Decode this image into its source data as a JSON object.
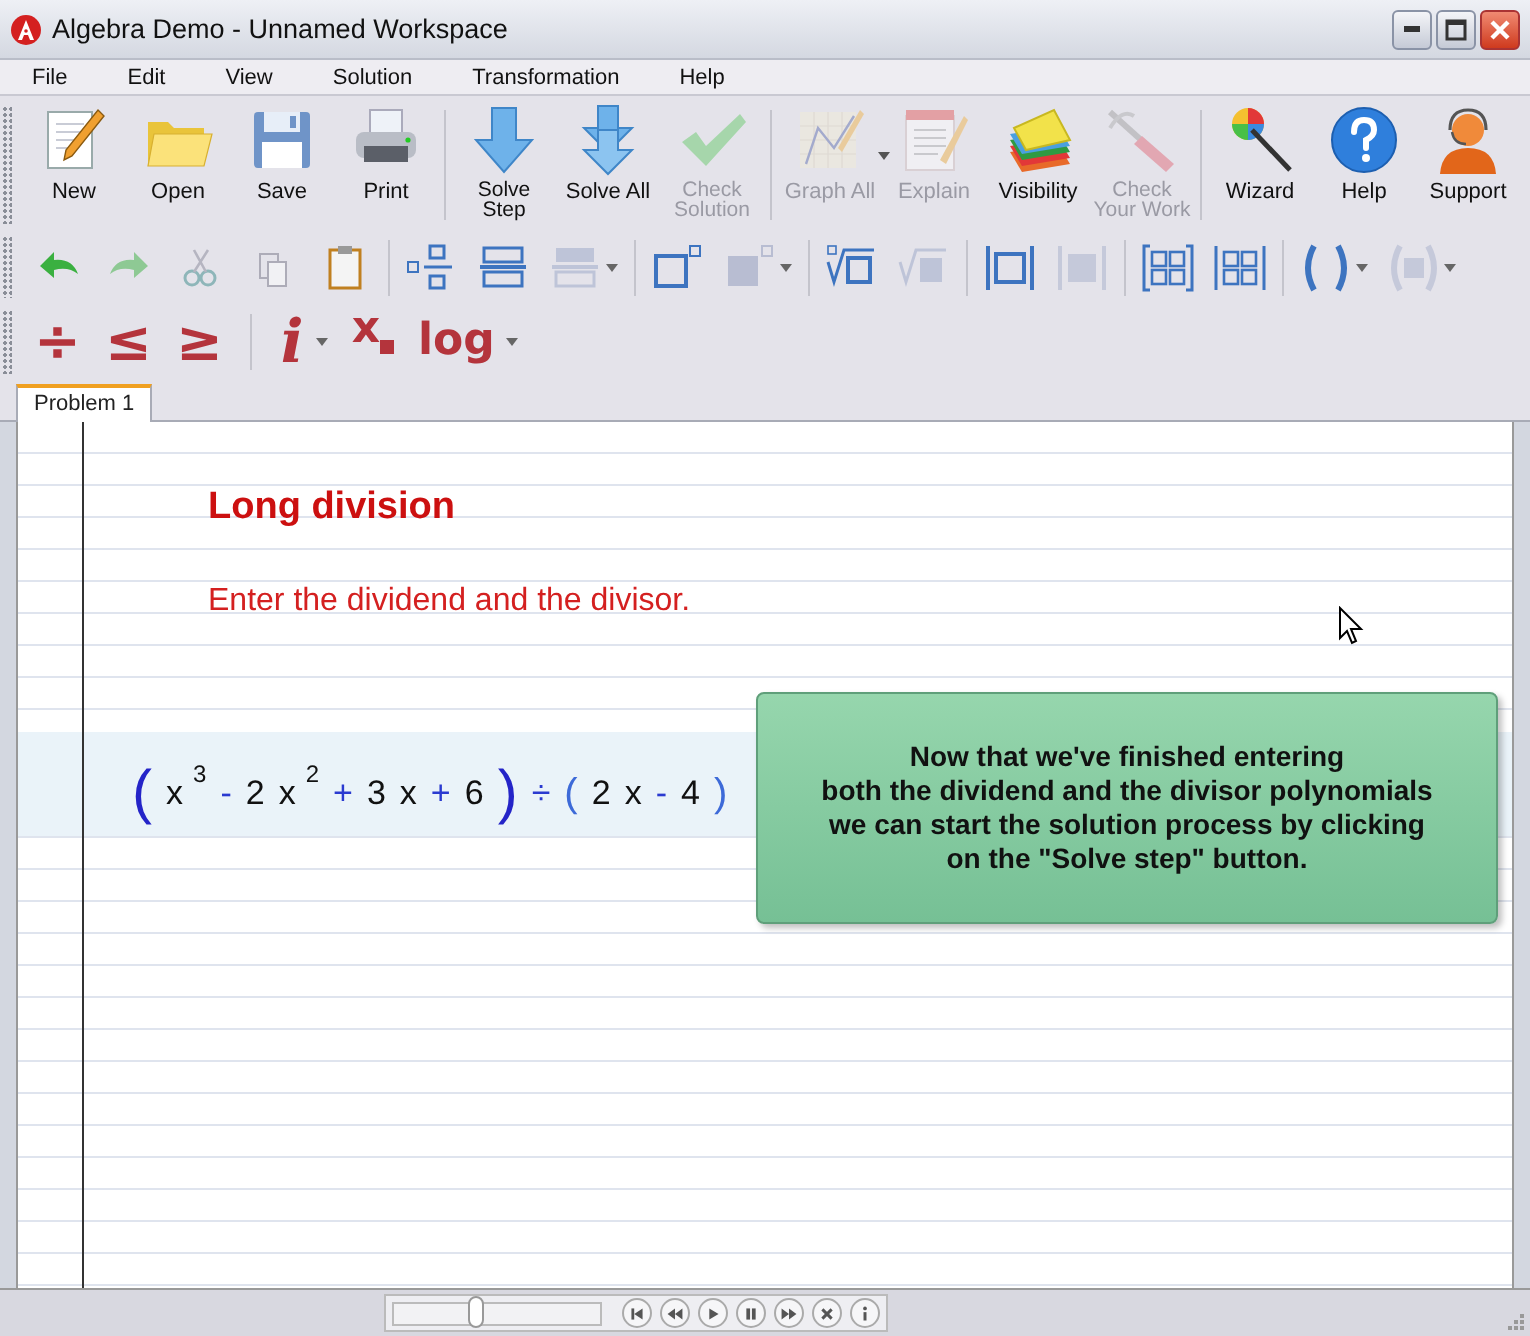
{
  "window": {
    "title": "Algebra Demo - Unnamed Workspace"
  },
  "menu": [
    "File",
    "Edit",
    "View",
    "Solution",
    "Transformation",
    "Help"
  ],
  "main_toolbar": {
    "groups": [
      {
        "buttons": [
          {
            "lines": [
              "New"
            ],
            "disabled": false,
            "dropdown": false
          },
          {
            "lines": [
              "Open"
            ],
            "disabled": false,
            "dropdown": false
          },
          {
            "lines": [
              "Save"
            ],
            "disabled": false,
            "dropdown": false
          },
          {
            "lines": [
              "Print"
            ],
            "disabled": false,
            "dropdown": false
          }
        ]
      },
      {
        "buttons": [
          {
            "lines": [
              "Solve",
              "Step"
            ],
            "disabled": false,
            "dropdown": false
          },
          {
            "lines": [
              "Solve All"
            ],
            "disabled": false,
            "dropdown": false
          },
          {
            "lines": [
              "Check",
              "Solution"
            ],
            "disabled": true,
            "dropdown": false
          }
        ]
      },
      {
        "buttons": [
          {
            "lines": [
              "Graph All"
            ],
            "disabled": true,
            "dropdown": true
          },
          {
            "lines": [
              "Explain"
            ],
            "disabled": true,
            "dropdown": false
          },
          {
            "lines": [
              "Visibility"
            ],
            "disabled": false,
            "dropdown": false
          },
          {
            "lines": [
              "Check",
              "Your Work"
            ],
            "disabled": true,
            "dropdown": false
          }
        ]
      },
      {
        "buttons": [
          {
            "lines": [
              "Wizard"
            ],
            "disabled": false,
            "dropdown": false
          },
          {
            "lines": [
              "Help"
            ],
            "disabled": false,
            "dropdown": false
          },
          {
            "lines": [
              "Support"
            ],
            "disabled": false,
            "dropdown": false
          }
        ]
      }
    ]
  },
  "format_toolbar": {
    "groups": [
      [
        {
          "disabled": false,
          "dropdown": false
        },
        {
          "disabled": true,
          "dropdown": false
        },
        {
          "disabled": true,
          "dropdown": false
        },
        {
          "disabled": true,
          "dropdown": false
        },
        {
          "disabled": false,
          "dropdown": false
        }
      ],
      [
        {
          "disabled": false,
          "dropdown": false
        },
        {
          "disabled": false,
          "dropdown": false
        },
        {
          "disabled": true,
          "dropdown": true
        }
      ],
      [
        {
          "disabled": false,
          "dropdown": false
        },
        {
          "disabled": true,
          "dropdown": true
        }
      ],
      [
        {
          "disabled": false,
          "dropdown": false
        },
        {
          "disabled": true,
          "dropdown": false
        }
      ],
      [
        {
          "disabled": false,
          "dropdown": false
        },
        {
          "disabled": true,
          "dropdown": false
        }
      ],
      [
        {
          "disabled": false,
          "dropdown": false
        },
        {
          "disabled": false,
          "dropdown": false
        }
      ],
      [
        {
          "disabled": false,
          "dropdown": true
        },
        {
          "disabled": true,
          "dropdown": true
        }
      ]
    ]
  },
  "symbol_toolbar": {
    "groups": [
      [
        {
          "symbol": "÷",
          "kind": "symbol",
          "dropdown": false
        },
        {
          "symbol": "≤",
          "kind": "symbol",
          "dropdown": false
        },
        {
          "symbol": "≥",
          "kind": "symbol",
          "dropdown": false
        }
      ],
      [
        {
          "symbol": "i",
          "kind": "italic",
          "dropdown": true
        },
        {
          "symbol": "x",
          "kind": "subscript",
          "dropdown": false
        },
        {
          "symbol": "log",
          "kind": "symbol",
          "dropdown": true
        }
      ]
    ]
  },
  "tabs": [
    {
      "label": "Problem 1",
      "selected": true
    }
  ],
  "page": {
    "heading": "Long division",
    "instruction": "Enter the dividend and the divisor.",
    "expression": [
      {
        "text": "(",
        "kind": "paren"
      },
      {
        "text": "x",
        "kind": "term"
      },
      {
        "text": "3",
        "kind": "exponent"
      },
      {
        "text": "-",
        "kind": "op"
      },
      {
        "text": "2",
        "kind": "term"
      },
      {
        "text": "x",
        "kind": "term"
      },
      {
        "text": "2",
        "kind": "exponent"
      },
      {
        "text": "+",
        "kind": "op"
      },
      {
        "text": "3",
        "kind": "term"
      },
      {
        "text": "x",
        "kind": "term"
      },
      {
        "text": "+",
        "kind": "op"
      },
      {
        "text": "6",
        "kind": "term"
      },
      {
        "text": ")",
        "kind": "paren"
      },
      {
        "text": "÷",
        "kind": "op"
      },
      {
        "text": "(",
        "kind": "small-paren"
      },
      {
        "text": "2",
        "kind": "term"
      },
      {
        "text": "x",
        "kind": "term"
      },
      {
        "text": "-",
        "kind": "op"
      },
      {
        "text": "4",
        "kind": "term"
      },
      {
        "text": ")",
        "kind": "small-paren"
      }
    ],
    "callout": {
      "lines": [
        "Now that we've finished entering",
        "both the dividend and the divisor polynomials",
        "we can start the solution process by clicking",
        "on the \"Solve step\" button."
      ]
    }
  },
  "playback": {
    "level": 0.4
  }
}
